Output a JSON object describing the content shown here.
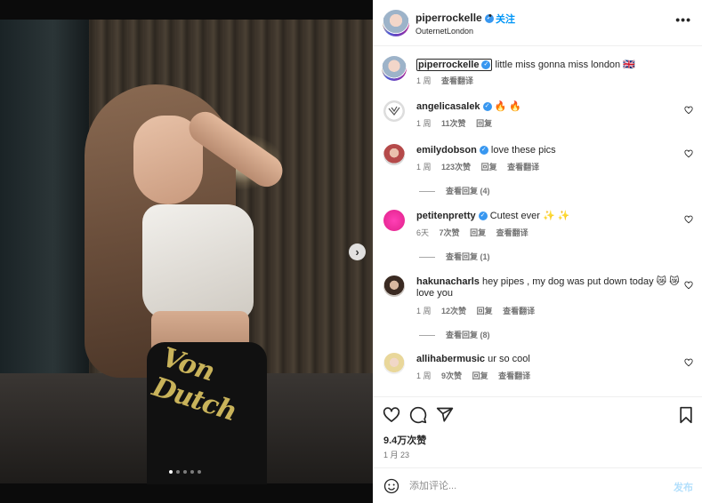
{
  "post": {
    "author": "piperrockelle",
    "follow_label": "关注",
    "separator": "•",
    "location": "OuternetLondon",
    "more_label": "•••",
    "carousel": {
      "total": 5,
      "active_index": 0,
      "next_label": "›"
    },
    "photo_text": "Von Dutch"
  },
  "caption": {
    "username": "piperrockelle",
    "text": "little miss gonna miss london 🇬🇧",
    "time": "1 周",
    "translate": "查看翻译"
  },
  "comments": [
    {
      "username": "angelicasalek",
      "text": "🔥 🔥",
      "time": "1 周",
      "likes": "11次赞",
      "reply": "回复",
      "translate": "",
      "verified": true
    },
    {
      "username": "emilydobson",
      "text": "love these pics",
      "time": "1 周",
      "likes": "123次赞",
      "reply": "回复",
      "translate": "查看翻译",
      "verified": true,
      "view_replies": "查看回复 (4)"
    },
    {
      "username": "petitenpretty",
      "text": "Cutest ever ✨ ✨",
      "time": "6天",
      "likes": "7次赞",
      "reply": "回复",
      "translate": "查看翻译",
      "verified": true,
      "view_replies": "查看回复 (1)"
    },
    {
      "username": "hakunacharls",
      "text": "hey pipes , my dog was put down today 😿 😿 love you",
      "time": "1 周",
      "likes": "12次赞",
      "reply": "回复",
      "translate": "查看翻译",
      "verified": false,
      "view_replies": "查看回复 (8)"
    },
    {
      "username": "allihabermusic",
      "text": "ur so cool",
      "time": "1 周",
      "likes": "9次赞",
      "reply": "回复",
      "translate": "查看翻译",
      "verified": false
    }
  ],
  "stats": {
    "likes": "9.4万次赞",
    "date": "1 月 23"
  },
  "composer": {
    "placeholder": "添加评论...",
    "post_label": "发布"
  },
  "colors": {
    "accent": "#0095f6",
    "verified": "#3897f0",
    "muted": "#737373"
  }
}
